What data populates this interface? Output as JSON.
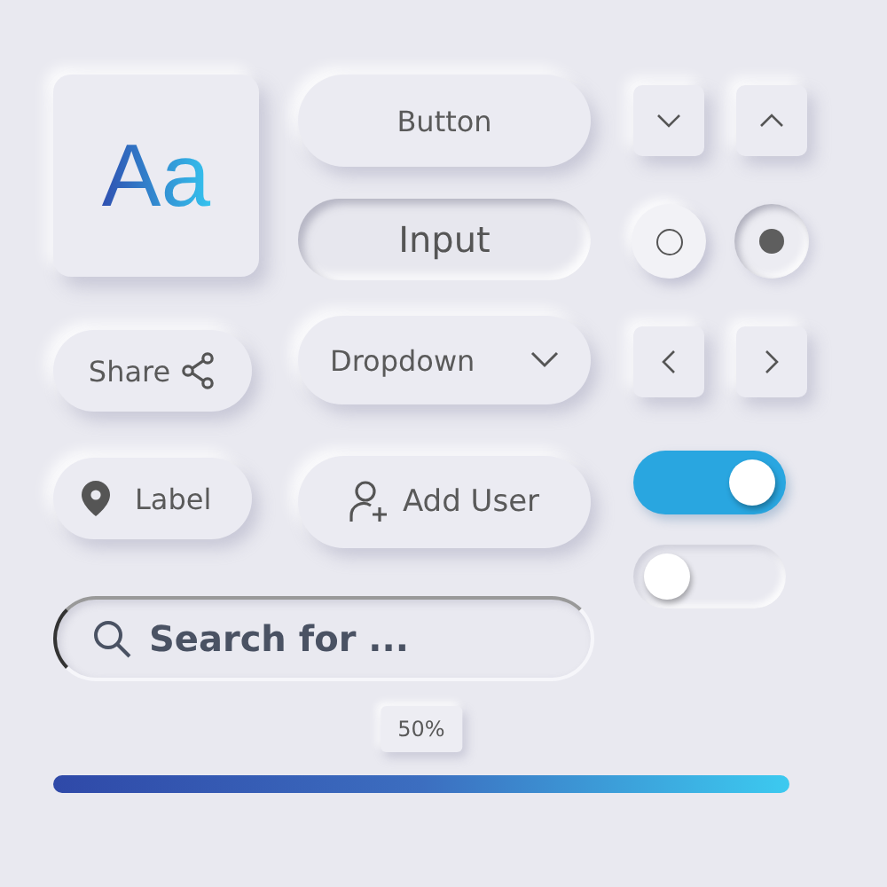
{
  "typography_sample": {
    "text": "Aa"
  },
  "button": {
    "label": "Button"
  },
  "input": {
    "value": "Input"
  },
  "share_button": {
    "label": "Share"
  },
  "dropdown": {
    "label": "Dropdown"
  },
  "location_label": {
    "label": "Label"
  },
  "add_user_button": {
    "label": "Add User"
  },
  "search": {
    "placeholder": "Search for ..."
  },
  "radios": [
    {
      "selected": false
    },
    {
      "selected": true
    }
  ],
  "toggles": [
    {
      "on": true
    },
    {
      "on": false
    }
  ],
  "progress": {
    "label": "50%",
    "level": 1
  }
}
